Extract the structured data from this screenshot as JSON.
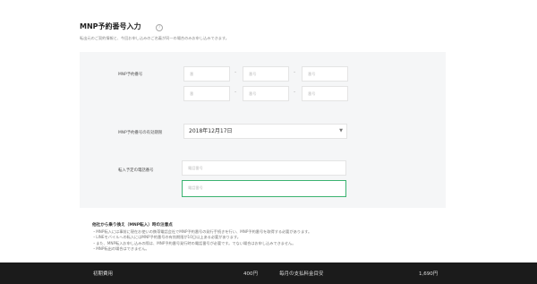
{
  "page": {
    "title": "MNP予約番号入力",
    "subtitle": "転出元のご契約情報と、今回お申し込みのご名義が同一の場合のみお申し込みできます。"
  },
  "form": {
    "reservation": {
      "label": "MNP予約番号",
      "fields": [
        "番",
        "番号",
        "番号",
        "番",
        "番号",
        "番号"
      ],
      "separator": "-"
    },
    "expiry": {
      "label": "MNP予約番号の有効期限",
      "value": "2018年12月17日"
    },
    "phone": {
      "label": "転入予定の電話番号",
      "placeholder1": "電話番号",
      "placeholder2": "電話番号"
    }
  },
  "notes": {
    "title": "他社から乗り換え（MNP転入）時の注意点",
    "items": [
      "・MNP転入には事前に現在お使いの携帯電話会社でMNP予約番号の発行手続きを行い、MNP予約番号を取得する必要があります。",
      "・LINEモバイルへの転入にはMNP予約番号の有効期限が10日以上ある必要があります。",
      "・また、MNP転入お申し込みの際は、MNP予約番号発行時の電話番号が必要です。でない場合はお申し込みできません。",
      "・MNP転出の場合はできません。"
    ]
  },
  "footer": {
    "initial_label": "初期費用",
    "initial_amount": "400円",
    "monthly_label": "毎月の支払料金目安",
    "monthly_amount": "1,690円"
  },
  "colors": {
    "panel": "#f5f6f7",
    "footer": "#1b1b1b",
    "focus_border": "#3cb371"
  }
}
